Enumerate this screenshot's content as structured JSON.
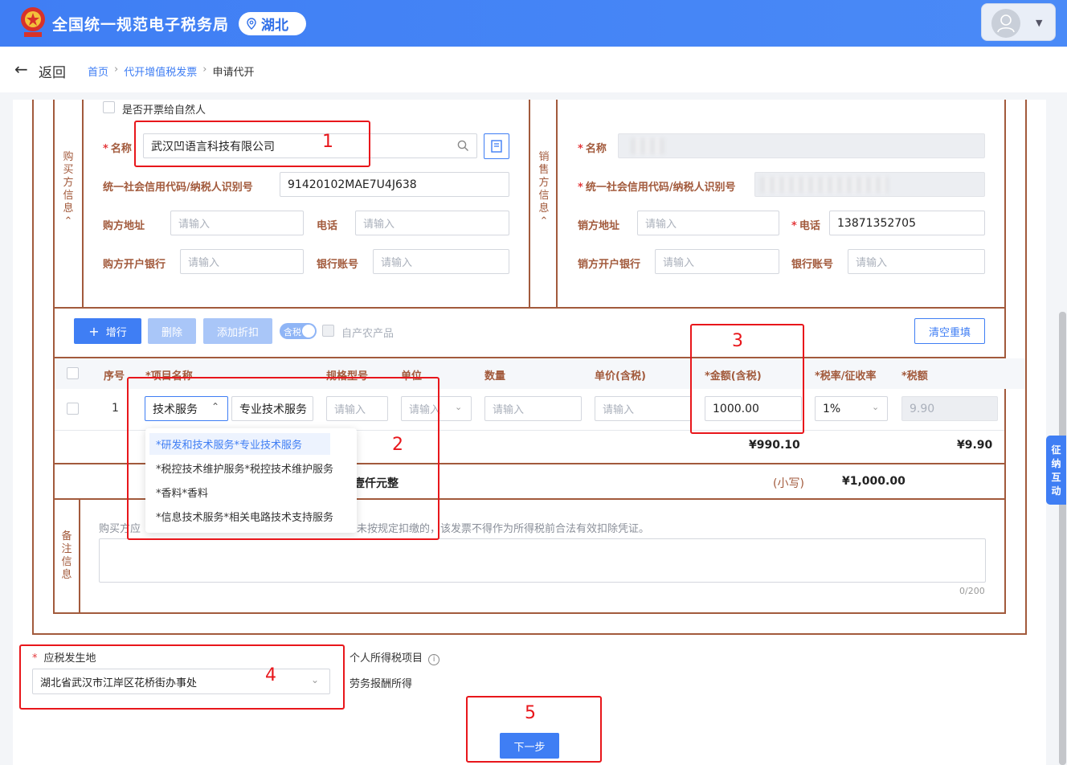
{
  "header": {
    "site_title": "全国统一规范电子税务局",
    "region": "湖北"
  },
  "nav": {
    "back": "返回",
    "breadcrumbs": [
      "首页",
      "代开增值税发票",
      "申请代开"
    ]
  },
  "buyer": {
    "section_label": [
      "购",
      "买",
      "方",
      "信",
      "息"
    ],
    "natural_person_checkbox": "是否开票给自然人",
    "name_label": "名称",
    "name_value": "武汉凹语言科技有限公司",
    "tax_id_label": "统一社会信用代码/纳税人识别号",
    "tax_id_value": "91420102MAE7U4J638",
    "address_label": "购方地址",
    "phone_label": "电话",
    "bank_label": "购方开户银行",
    "account_label": "银行账号",
    "placeholder": "请输入"
  },
  "seller": {
    "section_label": [
      "销",
      "售",
      "方",
      "信",
      "息"
    ],
    "name_label": "名称",
    "tax_id_label": "统一社会信用代码/纳税人识别号",
    "address_label": "销方地址",
    "phone_label": "电话",
    "phone_value": "13871352705",
    "bank_label": "销方开户银行",
    "account_label": "银行账号",
    "placeholder": "请输入"
  },
  "toolbar": {
    "add_row": "增行",
    "delete": "删除",
    "add_discount": "添加折扣",
    "tax_included": "含税",
    "self_produced": "自产农产品",
    "clear": "清空重填"
  },
  "table": {
    "headers": [
      "序号",
      "*项目名称",
      "规格型号",
      "单位",
      "数量",
      "单价(含税)",
      "*金额(含税)",
      "*税率/征收率",
      "*税额"
    ],
    "row": {
      "index": "1",
      "category": "技术服务",
      "item": "专业技术服务",
      "placeholder": "请输入",
      "amount": "1000.00",
      "rate": "1%",
      "tax": "9.90"
    },
    "dropdown_options": [
      "*研发和技术服务*专业技术服务",
      "*税控技术维护服务*税控技术维护服务",
      "*香料*香料",
      "*信息技术服务*相关电路技术支持服务"
    ],
    "subtotal_amount": "¥990.10",
    "subtotal_tax": "¥9.90",
    "total_uppercase_tail": "壹仟元整",
    "total_small_label": "(小写)",
    "total_small_value": "¥1,000.00"
  },
  "remark": {
    "section_label": [
      "备",
      "注",
      "信",
      "息"
    ],
    "hint_start": "购买方应",
    "hint_end": "未按规定扣缴的，该发票不得作为所得税前合法有效扣除凭证。",
    "counter": "0/200"
  },
  "footer": {
    "tax_place_label": "应税发生地",
    "tax_place_value": "湖北省武汉市江岸区花桥街办事处",
    "income_item_label": "个人所得税项目",
    "income_item_value": "劳务报酬所得",
    "next_button": "下一步"
  },
  "annotations": [
    "1",
    "2",
    "3",
    "4",
    "5"
  ],
  "side_tab": "征纳互动",
  "colors": {
    "primary": "#3f7ef4",
    "frame": "#a25a3c",
    "annotation": "#e8161b"
  }
}
